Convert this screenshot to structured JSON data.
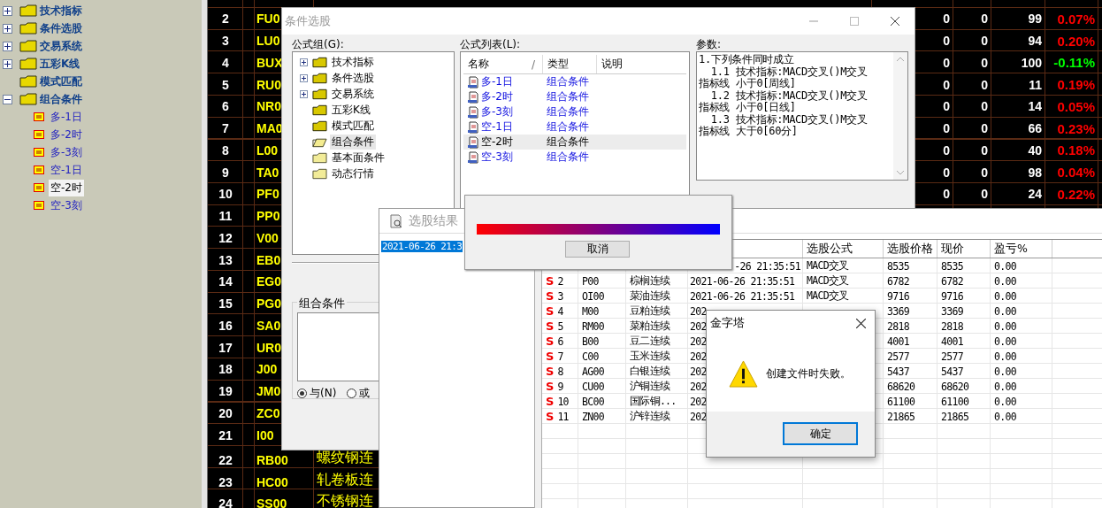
{
  "formula_tree": [
    {
      "label": "技术指标",
      "expanded": false
    },
    {
      "label": "条件选股",
      "expanded": false
    },
    {
      "label": "交易系统",
      "expanded": false
    },
    {
      "label": "五彩K线",
      "expanded": false
    },
    {
      "label": "模式匹配"
    },
    {
      "label": "组合条件",
      "expanded": true,
      "children": [
        {
          "label": "多-1日",
          "selected": false
        },
        {
          "label": "多-2时",
          "selected": false
        },
        {
          "label": "多-3刻",
          "selected": false
        },
        {
          "label": "空-1日",
          "selected": false
        },
        {
          "label": "空-2时",
          "selected": true
        },
        {
          "label": "空-3刻",
          "selected": false
        }
      ]
    }
  ],
  "quote_table": {
    "rows": [
      {
        "no": "2",
        "code": "FU0",
        "column_5": "0",
        "column_6": "0",
        "column_7": "99",
        "change": "0.07%",
        "color": "#ff0000"
      },
      {
        "no": "3",
        "code": "LU0",
        "column_5": "0",
        "column_6": "0",
        "column_7": "94",
        "change": "0.20%",
        "color": "#ff0000"
      },
      {
        "no": "4",
        "code": "BUX",
        "column_5": "0",
        "column_6": "0",
        "column_7": "100",
        "change": "-0.11%",
        "color": "#00ff00"
      },
      {
        "no": "5",
        "code": "RU0",
        "column_5": "0",
        "column_6": "0",
        "column_7": "11",
        "change": "0.19%",
        "color": "#ff0000"
      },
      {
        "no": "6",
        "code": "NR0",
        "column_5": "0",
        "column_6": "0",
        "column_7": "14",
        "change": "0.05%",
        "color": "#ff0000"
      },
      {
        "no": "7",
        "code": "MA0",
        "column_5": "0",
        "column_6": "0",
        "column_7": "66",
        "change": "0.23%",
        "color": "#ff0000"
      },
      {
        "no": "8",
        "code": "L00",
        "column_5": "0",
        "column_6": "0",
        "column_7": "40",
        "change": "0.18%",
        "color": "#ff0000"
      },
      {
        "no": "9",
        "code": "TA0",
        "column_5": "0",
        "column_6": "0",
        "column_7": "98",
        "change": "0.04%",
        "color": "#ff0000"
      },
      {
        "no": "10",
        "code": "PF0",
        "column_5": "0",
        "column_6": "0",
        "column_7": "24",
        "change": "0.22%",
        "color": "#ff0000"
      },
      {
        "no": "11",
        "code": "PP0"
      },
      {
        "no": "12",
        "code": "V00"
      },
      {
        "no": "13",
        "code": "EB0"
      },
      {
        "no": "14",
        "code": "EG0"
      },
      {
        "no": "15",
        "code": "PG0"
      },
      {
        "no": "16",
        "code": "SA0"
      },
      {
        "no": "17",
        "code": "UR0"
      },
      {
        "no": "18",
        "code": "J00"
      },
      {
        "no": "19",
        "code": "JM0"
      },
      {
        "no": "20",
        "code": "ZC0"
      },
      {
        "no": "21",
        "code": "I00"
      },
      {
        "no": "22",
        "code": "RB00",
        "name": "螺纹钢连"
      },
      {
        "no": "23",
        "code": "HC00",
        "name": "轧卷板连"
      },
      {
        "no": "24",
        "code": "SS00",
        "name": "不锈钢连"
      }
    ]
  },
  "screening_dialog": {
    "title": "条件选股",
    "formula_group_label": "公式组(G):",
    "formula_group_tree": [
      {
        "label": "技术指标",
        "kind": "folder",
        "expanded": false,
        "selected": false
      },
      {
        "label": "条件选股",
        "kind": "folder",
        "expanded": false,
        "selected": false
      },
      {
        "label": "交易系统",
        "kind": "folder",
        "expanded": false,
        "selected": false
      },
      {
        "label": "五彩K线",
        "kind": "folder",
        "selected": false
      },
      {
        "label": "模式匹配",
        "kind": "folder",
        "selected": false
      },
      {
        "label": "组合条件",
        "kind": "open-folder",
        "selected": true
      },
      {
        "label": "基本面条件",
        "kind": "empty-folder",
        "selected": false
      },
      {
        "label": "动态行情",
        "kind": "empty-folder",
        "selected": false
      }
    ],
    "formula_list_label": "公式列表(L):",
    "formula_list": {
      "columns": [
        "名称",
        "类型",
        "说明"
      ],
      "sort_mark": "/",
      "rows": [
        {
          "name": "多-1日",
          "type": "组合条件",
          "selected": false
        },
        {
          "name": "多-2时",
          "type": "组合条件",
          "selected": false
        },
        {
          "name": "多-3刻",
          "type": "组合条件",
          "selected": false
        },
        {
          "name": "空-1日",
          "type": "组合条件",
          "selected": false
        },
        {
          "name": "空-2时",
          "type": "组合条件",
          "selected": true
        },
        {
          "name": "空-3刻",
          "type": "组合条件",
          "selected": false
        }
      ]
    },
    "params_label": "参数:",
    "params_lines": [
      "1.下列条件同时成立",
      "  1.1 技术指标:MACD交叉()M交叉",
      "指标线 小于0[周线]",
      "  1.2 技术指标:MACD交叉()M交叉",
      "指标线 小于0[日线]",
      "  1.3 技术指标:MACD交叉()M交叉",
      "指标线 大于0[60分]"
    ],
    "combo_group": {
      "label": "组合条件",
      "options": [
        {
          "label": "与(N)",
          "selected": true
        },
        {
          "label": "或",
          "selected": false
        }
      ]
    }
  },
  "results_window": {
    "title": "选股结果",
    "history": [
      {
        "label": "2021-06-26 21:3",
        "selected": true
      }
    ],
    "columns": [
      "",
      "",
      "",
      "",
      "选股公式",
      "选股价格",
      "现价",
      "盈亏%"
    ],
    "rows": [
      {
        "time": "-26 21:35:51",
        "formula": "MACD交叉",
        "price": "8535",
        "current": "8535",
        "pnl": "0.00"
      },
      {
        "signal": "S",
        "no": "2",
        "code": "P00",
        "name": "棕榈连续",
        "time": "2021-06-26 21:35:51",
        "formula": "MACD交叉",
        "price": "6782",
        "current": "6782",
        "pnl": "0.00"
      },
      {
        "signal": "S",
        "no": "3",
        "code": "OI00",
        "name": "菜油连续",
        "time": "2021-06-26 21:35:51",
        "formula": "MACD交叉",
        "price": "9716",
        "current": "9716",
        "pnl": "0.00"
      },
      {
        "signal": "S",
        "no": "4",
        "code": "M00",
        "name": "豆粕连续",
        "time": "202",
        "price": "3369",
        "current": "3369",
        "pnl": "0.00"
      },
      {
        "signal": "S",
        "no": "5",
        "code": "RM00",
        "name": "菜粕连续",
        "time": "202",
        "price": "2818",
        "current": "2818",
        "pnl": "0.00"
      },
      {
        "signal": "S",
        "no": "6",
        "code": "B00",
        "name": "豆二连续",
        "time": "202",
        "price": "4001",
        "current": "4001",
        "pnl": "0.00"
      },
      {
        "signal": "S",
        "no": "7",
        "code": "C00",
        "name": "玉米连续",
        "time": "202",
        "price": "2577",
        "current": "2577",
        "pnl": "0.00"
      },
      {
        "signal": "S",
        "no": "8",
        "code": "AG00",
        "name": "白银连续",
        "time": "202",
        "price": "5437",
        "current": "5437",
        "pnl": "0.00"
      },
      {
        "signal": "S",
        "no": "9",
        "code": "CU00",
        "name": "沪铜连续",
        "time": "202",
        "price": "68620",
        "current": "68620",
        "pnl": "0.00"
      },
      {
        "signal": "S",
        "no": "10",
        "code": "BC00",
        "name": "国际铜...",
        "time": "202",
        "price": "61100",
        "current": "61100",
        "pnl": "0.00"
      },
      {
        "signal": "S",
        "no": "11",
        "code": "ZN00",
        "name": "沪锌连续",
        "time": "202",
        "price": "21865",
        "current": "21865",
        "pnl": "0.00"
      }
    ]
  },
  "progress_dialog": {
    "level": 1,
    "cancel": "取消"
  },
  "message_box": {
    "title": "金字塔",
    "message": "创建文件时失败。",
    "ok": "确定"
  }
}
